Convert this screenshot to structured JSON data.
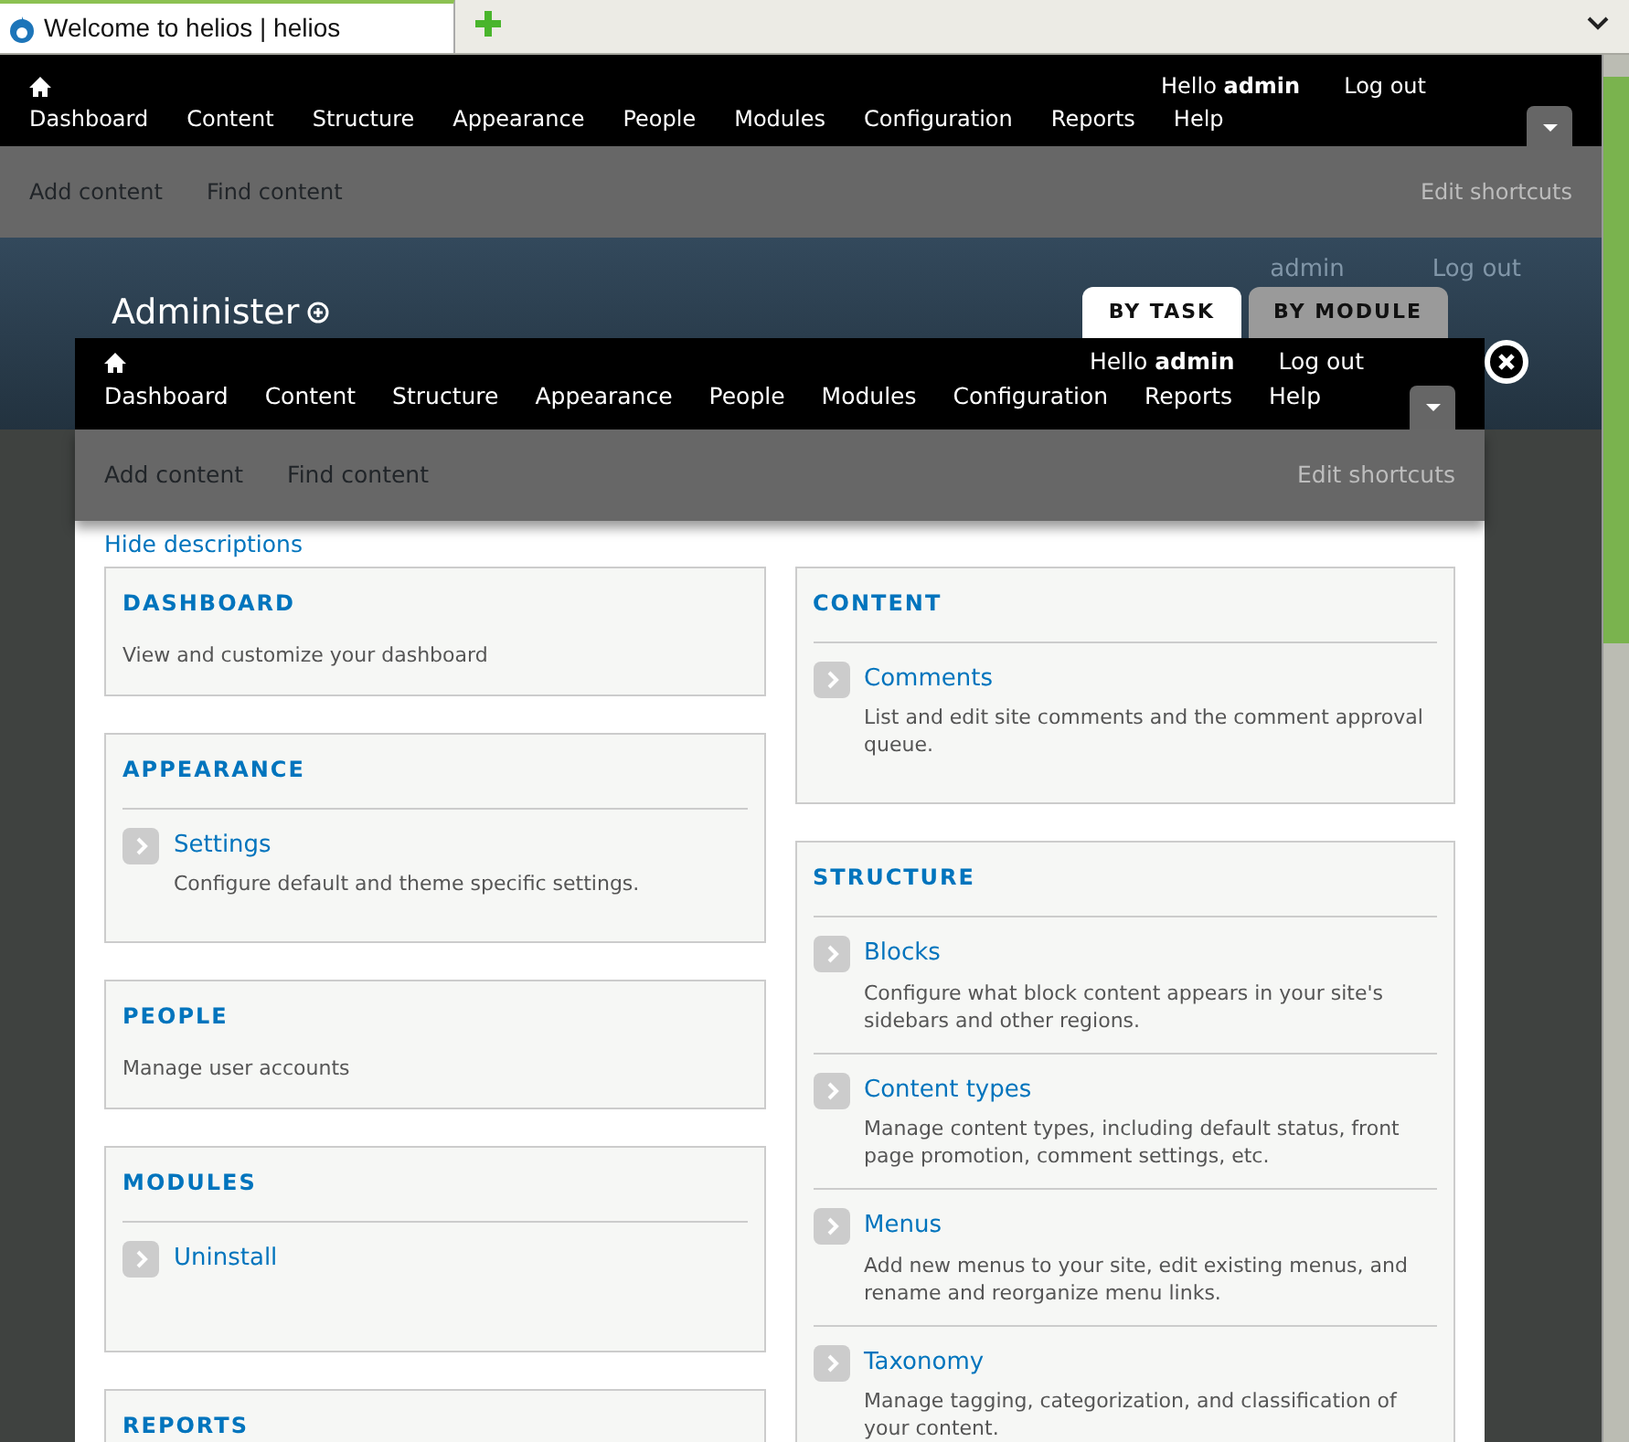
{
  "browser": {
    "tabs": [
      {
        "title": "Welcome to helios | helios",
        "selected": true
      }
    ]
  },
  "toolbar": {
    "menu": [
      "Dashboard",
      "Content",
      "Structure",
      "Appearance",
      "People",
      "Modules",
      "Configuration",
      "Reports",
      "Help"
    ],
    "greeting": "Hello **admin**",
    "logout": "Log out"
  },
  "shortcuts": {
    "items": [
      "Add content",
      "Find content"
    ],
    "edit": "Edit shortcuts"
  },
  "background_page": {
    "user": "admin",
    "logout": "Log out",
    "title": "Administer",
    "tabs": [
      {
        "label": "BY TASK",
        "selected": true
      },
      {
        "label": "BY MODULE",
        "selected": false
      }
    ]
  },
  "overlay": {
    "toolbar": {
      "menu": [
        "Dashboard",
        "Content",
        "Structure",
        "Appearance",
        "People",
        "Modules",
        "Configuration",
        "Reports",
        "Help"
      ],
      "greeting": "Hello **admin**",
      "logout": "Log out"
    },
    "shortcuts": {
      "items": [
        "Add content",
        "Find content"
      ],
      "edit": "Edit shortcuts"
    },
    "hide_descriptions": "Hide descriptions",
    "columns": [
      [
        {
          "kind": "text",
          "title": "DASHBOARD",
          "description": "View and customize your dashboard"
        },
        {
          "kind": "links",
          "title": "APPEARANCE",
          "items": [
            {
              "label": "Settings",
              "description": "Configure default and theme specific settings."
            }
          ]
        },
        {
          "kind": "text",
          "title": "PEOPLE",
          "description": "Manage user accounts"
        },
        {
          "kind": "links",
          "title": "MODULES",
          "items": [
            {
              "label": "Uninstall"
            }
          ]
        },
        {
          "kind": "links",
          "title": "REPORTS"
        }
      ],
      [
        {
          "kind": "links",
          "title": "CONTENT",
          "items": [
            {
              "label": "Comments",
              "description": "List and edit site comments and the comment approval queue."
            }
          ]
        },
        {
          "kind": "links",
          "title": "STRUCTURE",
          "items": [
            {
              "label": "Blocks",
              "description": "Configure what block content appears in your site's sidebars and other regions."
            },
            {
              "label": "Content types",
              "description": "Manage content types, including default status, front page promotion, comment settings, etc."
            },
            {
              "label": "Menus",
              "description": "Add new menus to your site, edit existing menus, and rename and reorganize menu links."
            },
            {
              "label": "Taxonomy",
              "description": "Manage tagging, categorization, and classification of your content."
            }
          ]
        }
      ]
    ]
  }
}
